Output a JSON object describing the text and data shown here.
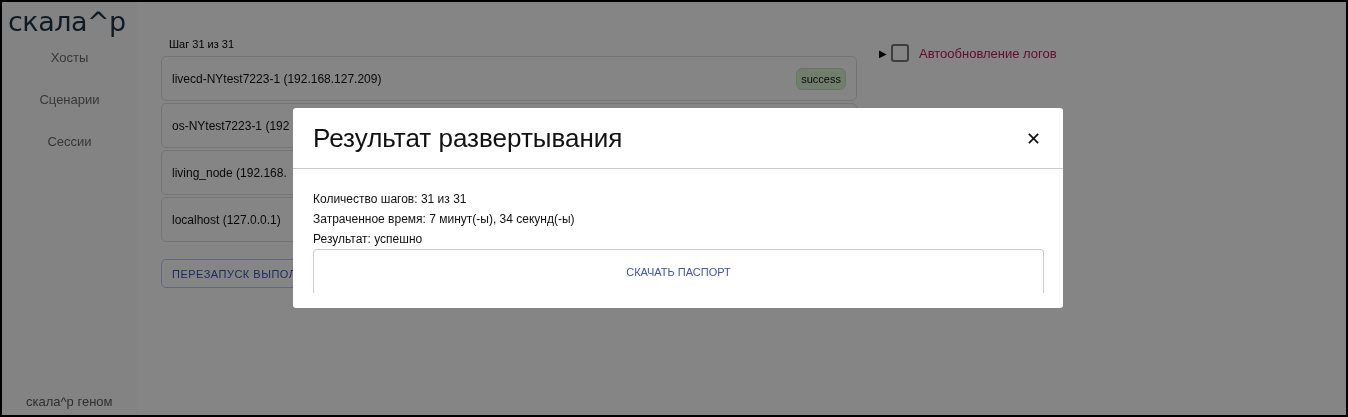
{
  "logo": "скала^р",
  "sidebar": {
    "items": [
      {
        "label": "Хосты"
      },
      {
        "label": "Сценарии"
      },
      {
        "label": "Сессии"
      }
    ],
    "footer": "скала^р геном"
  },
  "step": "Шаг 31 из 31",
  "hosts": [
    {
      "name": "livecd-NYtest7223-1 (192.168.127.209)",
      "status": "success"
    },
    {
      "name": "os-NYtest7223-1 (192"
    },
    {
      "name": "living_node (192.168."
    },
    {
      "name": "localhost (127.0.0.1)"
    }
  ],
  "restart_button": "ПЕРЕЗАПУСК ВЫПОЛ",
  "autoupdate": {
    "expand_icon": "▶",
    "checked": false,
    "label": "Автообновление логов"
  },
  "dialog": {
    "title": "Результат развертывания",
    "close": "✕",
    "lines": [
      "Количество шагов: 31 из 31",
      "Затраченное время: 7 минут(-ы), 34 секунд(-ы)",
      "Результат: успешно"
    ],
    "button": "СКАЧАТЬ ПАСПОРТ"
  }
}
